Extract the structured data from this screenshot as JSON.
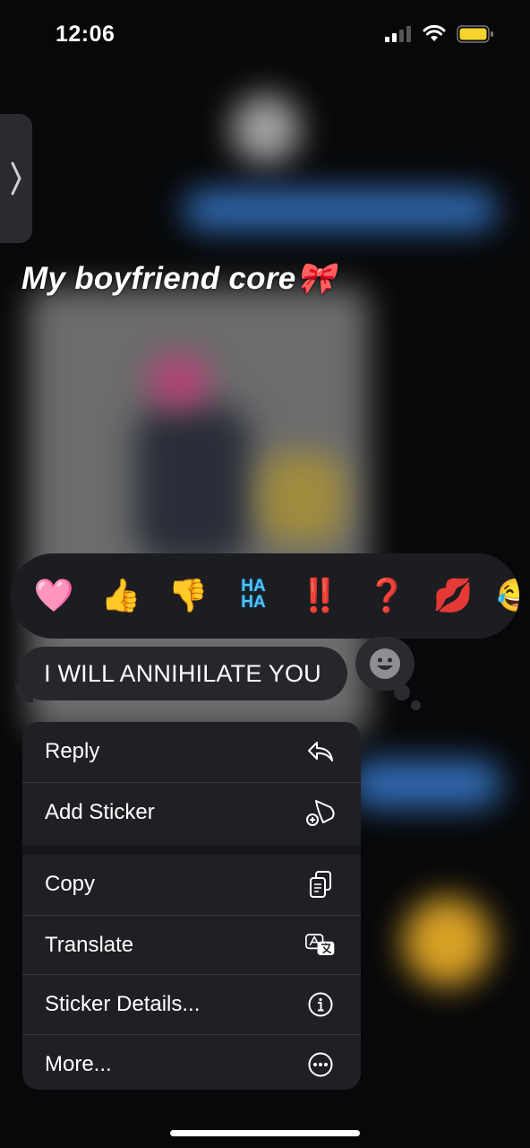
{
  "status_bar": {
    "time": "12:06",
    "battery_color": "#f6d32d"
  },
  "sticker_caption": "My boyfriend core🎀",
  "reactions": [
    {
      "name": "heart-reaction",
      "glyph": "🩷"
    },
    {
      "name": "thumbs-up-reaction",
      "glyph": "👍"
    },
    {
      "name": "thumbs-down-reaction",
      "glyph": "👎"
    },
    {
      "name": "haha-reaction",
      "text_top": "HA",
      "text_bottom": "HA"
    },
    {
      "name": "exclamation-reaction",
      "glyph": "‼️"
    },
    {
      "name": "question-reaction",
      "glyph": "❓"
    },
    {
      "name": "kiss-reaction",
      "glyph": "💋"
    },
    {
      "name": "more-emoji-reaction",
      "glyph": "😂"
    }
  ],
  "message": {
    "text": "I WILL ANNIHILATE YOU"
  },
  "menu": {
    "reply": "Reply",
    "add_sticker": "Add Sticker",
    "copy": "Copy",
    "translate": "Translate",
    "sticker_details": "Sticker Details...",
    "more": "More..."
  }
}
